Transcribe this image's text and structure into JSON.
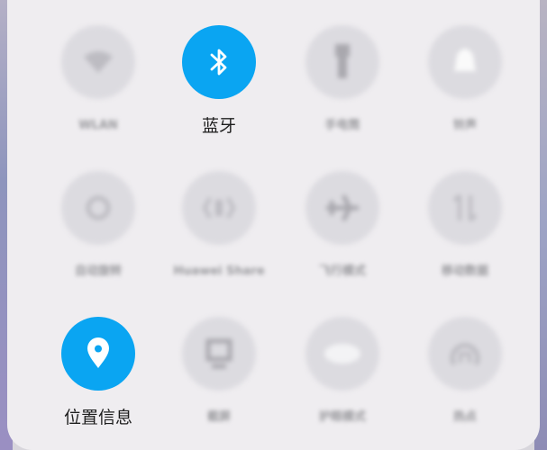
{
  "quick_settings": {
    "tiles": [
      {
        "label": "WLAN",
        "icon": "wifi-icon",
        "active": false
      },
      {
        "label": "蓝牙",
        "icon": "bluetooth-icon",
        "active": true
      },
      {
        "label": "手电筒",
        "icon": "flashlight-icon",
        "active": false
      },
      {
        "label": "铃声",
        "icon": "bell-icon",
        "active": false
      },
      {
        "label": "自动旋转",
        "icon": "auto-rotate-icon",
        "active": false
      },
      {
        "label": "Huawei Share",
        "icon": "huawei-share-icon",
        "active": false
      },
      {
        "label": "飞行模式",
        "icon": "airplane-icon",
        "active": false
      },
      {
        "label": "移动数据",
        "icon": "mobile-data-icon",
        "active": false
      },
      {
        "label": "位置信息",
        "icon": "location-icon",
        "active": true
      },
      {
        "label": "截屏",
        "icon": "screenshot-icon",
        "active": false
      },
      {
        "label": "护眼模式",
        "icon": "eye-comfort-icon",
        "active": false
      },
      {
        "label": "热点",
        "icon": "hotspot-icon",
        "active": false
      }
    ]
  },
  "colors": {
    "active": "#0aa5f2",
    "inactive": "#dcdbe0",
    "panel": "#efedf0"
  }
}
